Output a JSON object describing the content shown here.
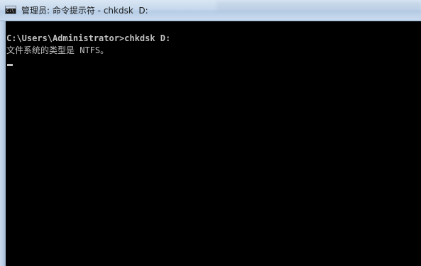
{
  "window": {
    "title": "管理员: 命令提示符 - chkdsk  D:"
  },
  "app_icon": {
    "name": "cmd-icon",
    "text": "C:\\"
  },
  "console": {
    "lines": [
      "C:\\Users\\Administrator>chkdsk D:",
      "文件系统的类型是 NTFS。"
    ],
    "cursor": "_"
  },
  "colors": {
    "console_bg": "#000000",
    "console_text": "#c0c0c0",
    "titlebar": "#c6d8ec"
  }
}
